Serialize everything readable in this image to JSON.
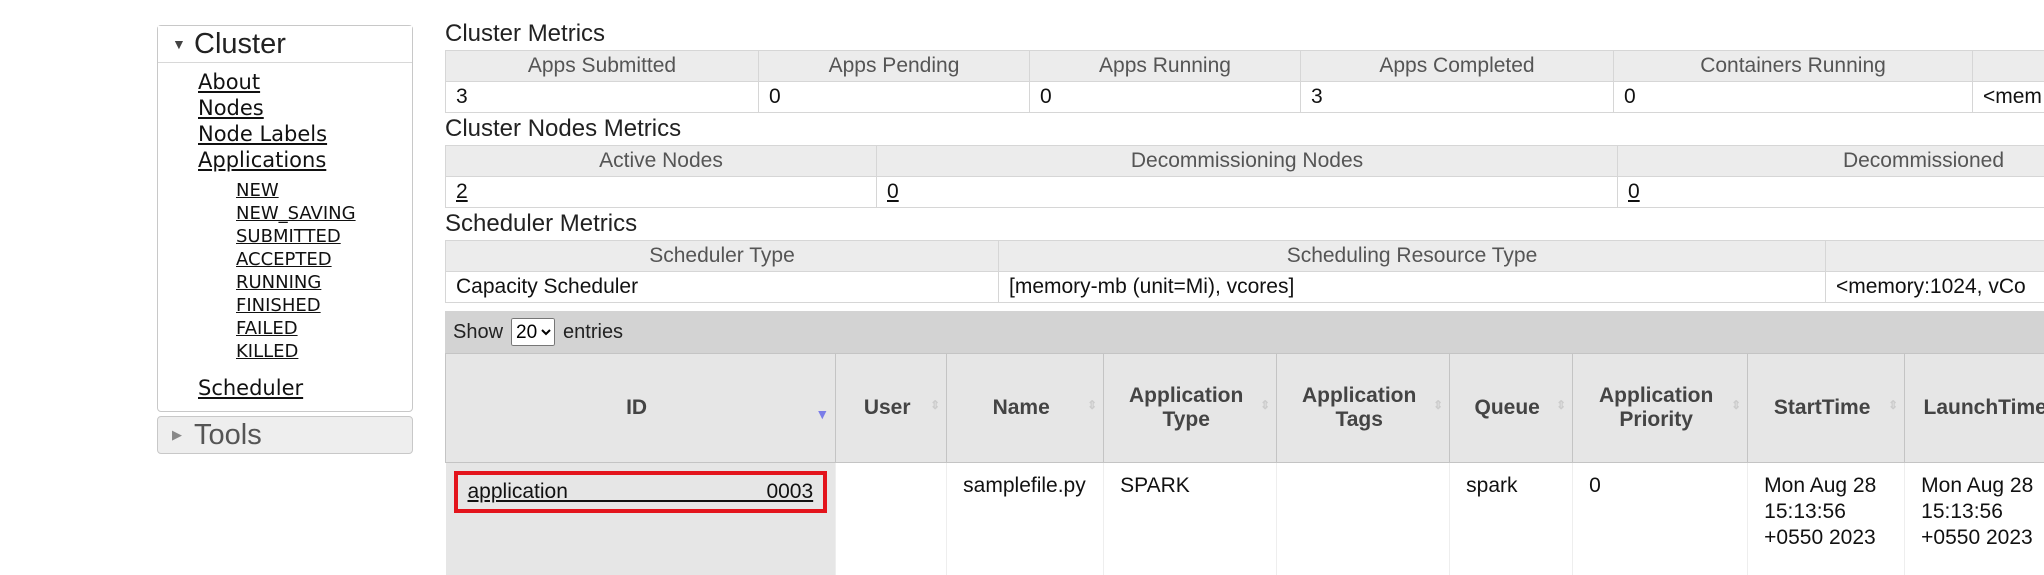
{
  "sidebar": {
    "cluster": {
      "title": "Cluster",
      "links": [
        "About",
        "Nodes",
        "Node Labels",
        "Applications"
      ],
      "app_states": [
        "NEW",
        "NEW_SAVING",
        "SUBMITTED",
        "ACCEPTED",
        "RUNNING",
        "FINISHED",
        "FAILED",
        "KILLED"
      ],
      "scheduler": "Scheduler"
    },
    "tools": {
      "title": "Tools"
    }
  },
  "cluster_metrics": {
    "title": "Cluster Metrics",
    "headers": [
      "Apps Submitted",
      "Apps Pending",
      "Apps Running",
      "Apps Completed",
      "Containers Running",
      ""
    ],
    "values": [
      "3",
      "0",
      "0",
      "3",
      "0",
      "<mem"
    ]
  },
  "nodes_metrics": {
    "title": "Cluster Nodes Metrics",
    "headers": [
      "Active Nodes",
      "Decommissioning Nodes",
      "Decommissioned"
    ],
    "values": [
      "2",
      "0",
      "0"
    ]
  },
  "scheduler_metrics": {
    "title": "Scheduler Metrics",
    "headers": [
      "Scheduler Type",
      "Scheduling Resource Type",
      ""
    ],
    "values": [
      "Capacity Scheduler",
      "[memory-mb (unit=Mi), vcores]",
      "<memory:1024, vCo"
    ]
  },
  "apps_table": {
    "show_label": "Show",
    "entries_value": "20",
    "entries_label": "entries",
    "columns": [
      "ID",
      "User",
      "Name",
      "Application Type",
      "Application Tags",
      "Queue",
      "Application Priority",
      "StartTime",
      "LaunchTime"
    ],
    "row": {
      "id": "application_________________0003",
      "user": "",
      "name": "samplefile.py",
      "type": "SPARK",
      "tags": "",
      "queue": "spark",
      "priority": "0",
      "start_time": "Mon Aug 28 15:13:56 +0550 2023",
      "launch_time": "Mon Aug 28 15:13:56 +0550 2023"
    }
  },
  "colors": {
    "highlight_border": "#e3141c",
    "sort_active": "#7a7de8"
  }
}
